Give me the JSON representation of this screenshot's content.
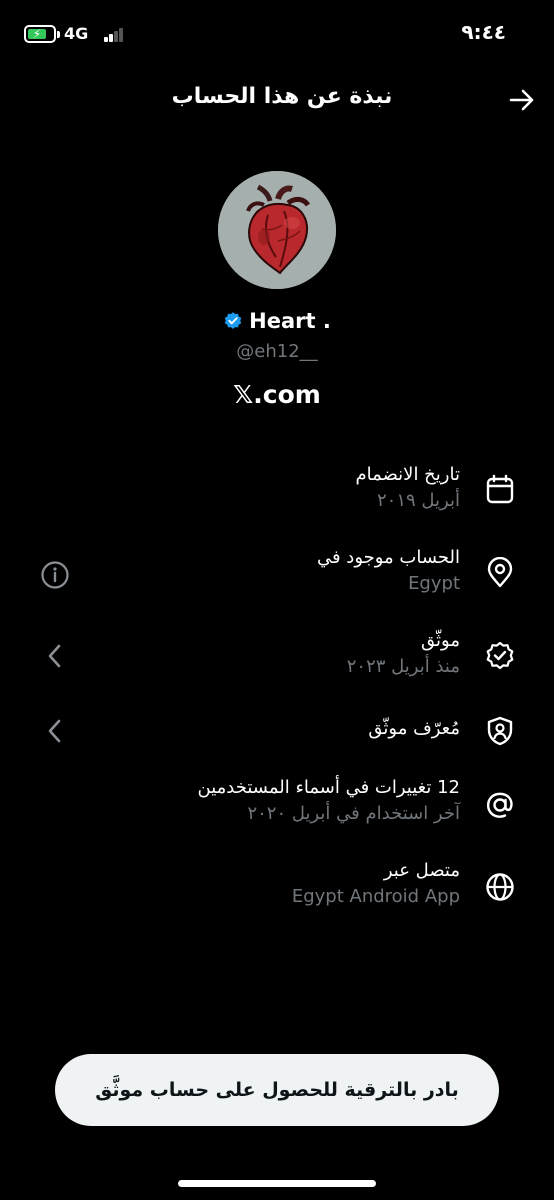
{
  "status_bar": {
    "network": "4G",
    "time": "٩:٤٤",
    "battery_level": 0.75,
    "battery_color": "#34c759"
  },
  "header": {
    "title": "نبذة عن هذا الحساب",
    "back_icon": "arrow-right-icon"
  },
  "profile": {
    "display_name": "Heart .",
    "handle": "@eh12__",
    "verified_color": "#1d9bf0",
    "platform": "𝕏.com"
  },
  "rows": [
    {
      "title": "تاريخ الانضمام",
      "subtitle": "أبريل ٢٠١٩",
      "icon": "calendar-icon"
    },
    {
      "title": "الحساب موجود في",
      "subtitle": "Egypt",
      "icon": "location-pin-icon",
      "trailing": "info-icon"
    },
    {
      "title": "موثّق",
      "subtitle": "منذ أبريل ٢٠٢٣",
      "icon": "verified-badge-icon",
      "trailing": "chevron-left-icon"
    },
    {
      "title": "مُعرّف موثّق",
      "subtitle": "",
      "icon": "shield-user-icon",
      "trailing": "chevron-left-icon"
    },
    {
      "title": "12 تغييرات في أسماء المستخدمين",
      "subtitle": "آخر استخدام في أبريل ٢٠٢٠",
      "icon": "at-sign-icon"
    },
    {
      "title": "متصل عبر",
      "subtitle": "Egypt Android App",
      "icon": "globe-icon"
    }
  ],
  "upgrade_button": {
    "label": "بادر بالترقية للحصول على حساب موثَّق"
  }
}
